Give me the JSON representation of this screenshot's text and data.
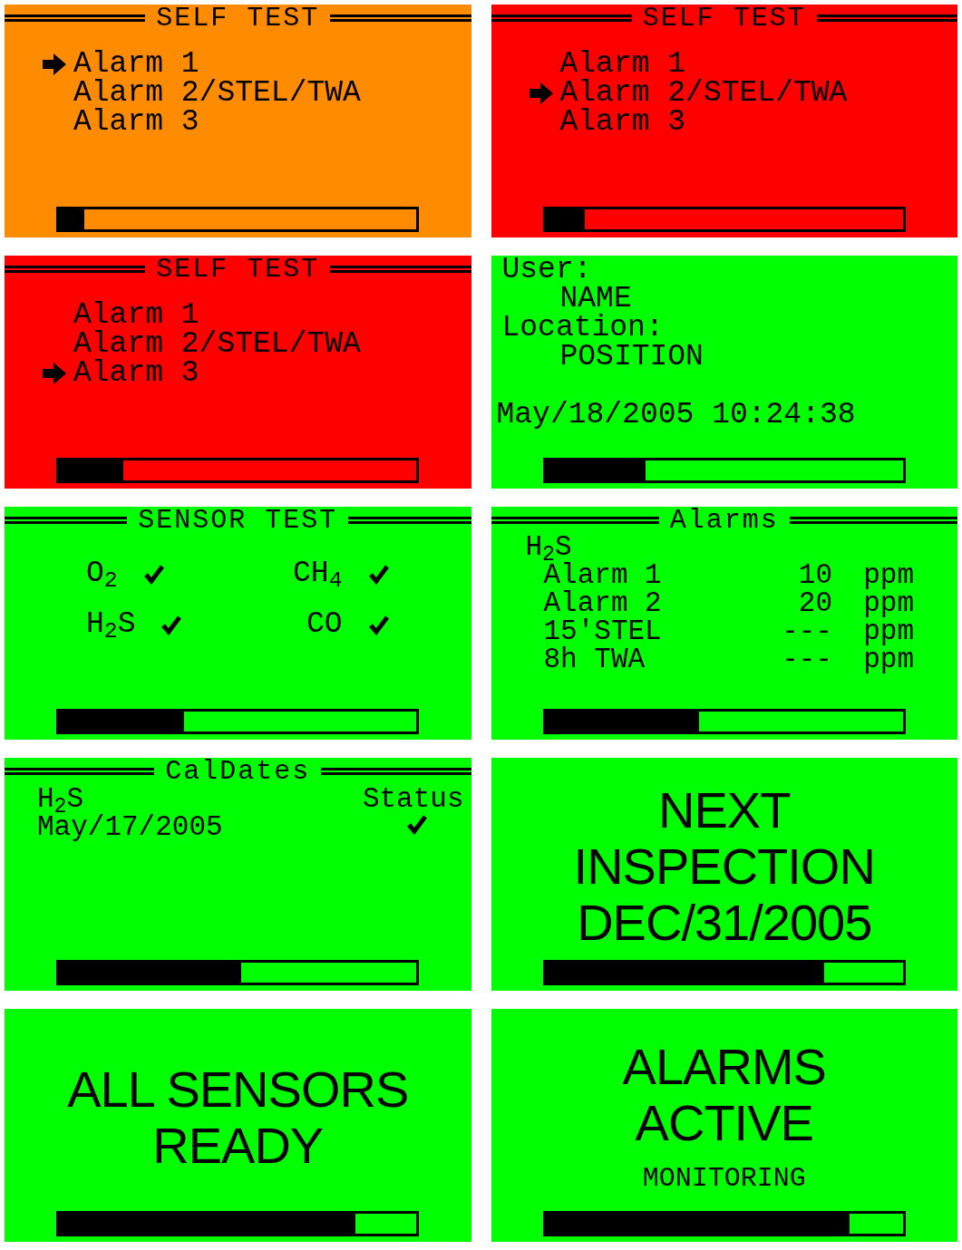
{
  "screens": [
    {
      "kind": "menu",
      "color": "#ff8c00",
      "title": "SELF TEST",
      "level": 0.07,
      "items": [
        {
          "label": "Alarm 1",
          "selected": true
        },
        {
          "label": "Alarm 2/STEL/TWA",
          "selected": false
        },
        {
          "label": "Alarm 3",
          "selected": false
        }
      ]
    },
    {
      "kind": "menu",
      "color": "#ff0000",
      "title": "SELF TEST",
      "level": 0.11,
      "items": [
        {
          "label": "Alarm 1",
          "selected": false
        },
        {
          "label": "Alarm 2/STEL/TWA",
          "selected": true
        },
        {
          "label": "Alarm 3",
          "selected": false
        }
      ]
    },
    {
      "kind": "menu",
      "color": "#ff0000",
      "title": "SELF TEST",
      "level": 0.18,
      "items": [
        {
          "label": "Alarm 1",
          "selected": false
        },
        {
          "label": "Alarm 2/STEL/TWA",
          "selected": false
        },
        {
          "label": "Alarm 3",
          "selected": true
        }
      ]
    },
    {
      "kind": "info",
      "color": "#00ff00",
      "level": 0.28,
      "fields": [
        {
          "label": "User:",
          "value": "NAME"
        },
        {
          "label": "Location:",
          "value": "POSITION"
        }
      ],
      "timestamp": "May/18/2005 10:24:38"
    },
    {
      "kind": "sensors",
      "color": "#00ff00",
      "title": "SENSOR TEST",
      "level": 0.35,
      "sensors": [
        {
          "name": "O$_{2}$",
          "checked": true
        },
        {
          "name": "CH$_{4}$",
          "checked": true
        },
        {
          "name": "H$_{2}$S",
          "checked": true
        },
        {
          "name": "CO",
          "checked": true
        }
      ]
    },
    {
      "kind": "alarms",
      "color": "#00ff00",
      "title": "Alarms",
      "level": 0.43,
      "gas": "H$_{2}$S",
      "rows": [
        {
          "label": "Alarm 1",
          "value": "10",
          "unit": "ppm"
        },
        {
          "label": "Alarm 2",
          "value": "20",
          "unit": "ppm"
        },
        {
          "label": "15'STEL",
          "value": "---",
          "unit": "ppm"
        },
        {
          "label": "8h TWA",
          "value": "---",
          "unit": "ppm"
        }
      ]
    },
    {
      "kind": "caldates",
      "color": "#00ff00",
      "title": "CalDates",
      "level": 0.51,
      "gas": "H$_{2}$S",
      "date": "May/17/2005",
      "status_label": "Status",
      "checked": true
    },
    {
      "kind": "big",
      "color": "#00ff00",
      "level": 0.78,
      "lines": [
        "NEXT",
        "INSPECTION",
        "DEC/31/2005"
      ]
    },
    {
      "kind": "big",
      "color": "#00ff00",
      "level": 0.83,
      "lines": [
        "ALL SENSORS",
        "READY"
      ]
    },
    {
      "kind": "big",
      "color": "#00ff00",
      "level": 0.85,
      "lines": [
        "ALARMS",
        "ACTIVE"
      ],
      "subtitle": "MONITORING"
    }
  ]
}
